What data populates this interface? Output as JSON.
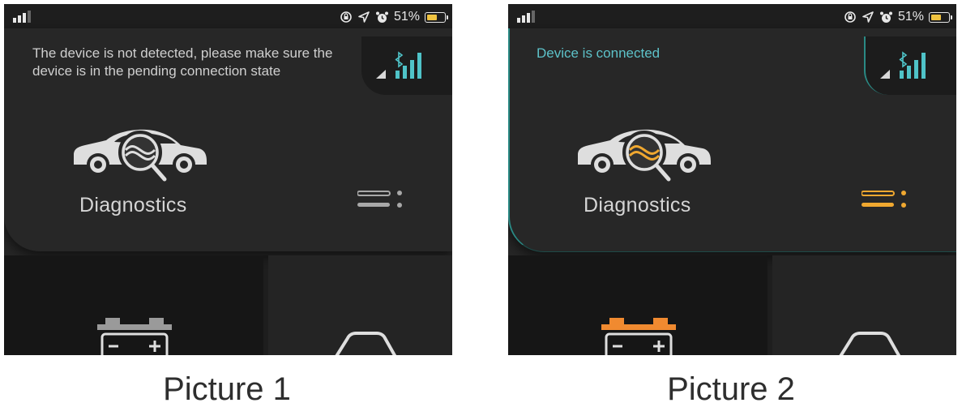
{
  "pictures": [
    {
      "status_bar": {
        "battery_percent": "51%"
      },
      "connection": {
        "message": "The device is not detected, please make sure the device is in the pending connection state",
        "connected": false
      },
      "main_feature": {
        "label": "Diagnostics",
        "icon": "car-diagnostics-icon"
      },
      "colors": {
        "accent": "#a8a8a8",
        "car_badge": "#dedede"
      },
      "caption": "Picture 1"
    },
    {
      "status_bar": {
        "battery_percent": "51%"
      },
      "connection": {
        "message": "Device is connected",
        "connected": true
      },
      "main_feature": {
        "label": "Diagnostics",
        "icon": "car-diagnostics-icon"
      },
      "colors": {
        "accent": "#f0a830",
        "car_badge": "#f0a830"
      },
      "caption": "Picture 2"
    }
  ],
  "colors": {
    "bluetooth": "#4fc3c8",
    "signal_bars": "#4fc3c8",
    "battery_fill": "#f0c340",
    "battery_tile_icon_off": "#9a9a9a",
    "battery_tile_icon_on": "#f08a30"
  }
}
